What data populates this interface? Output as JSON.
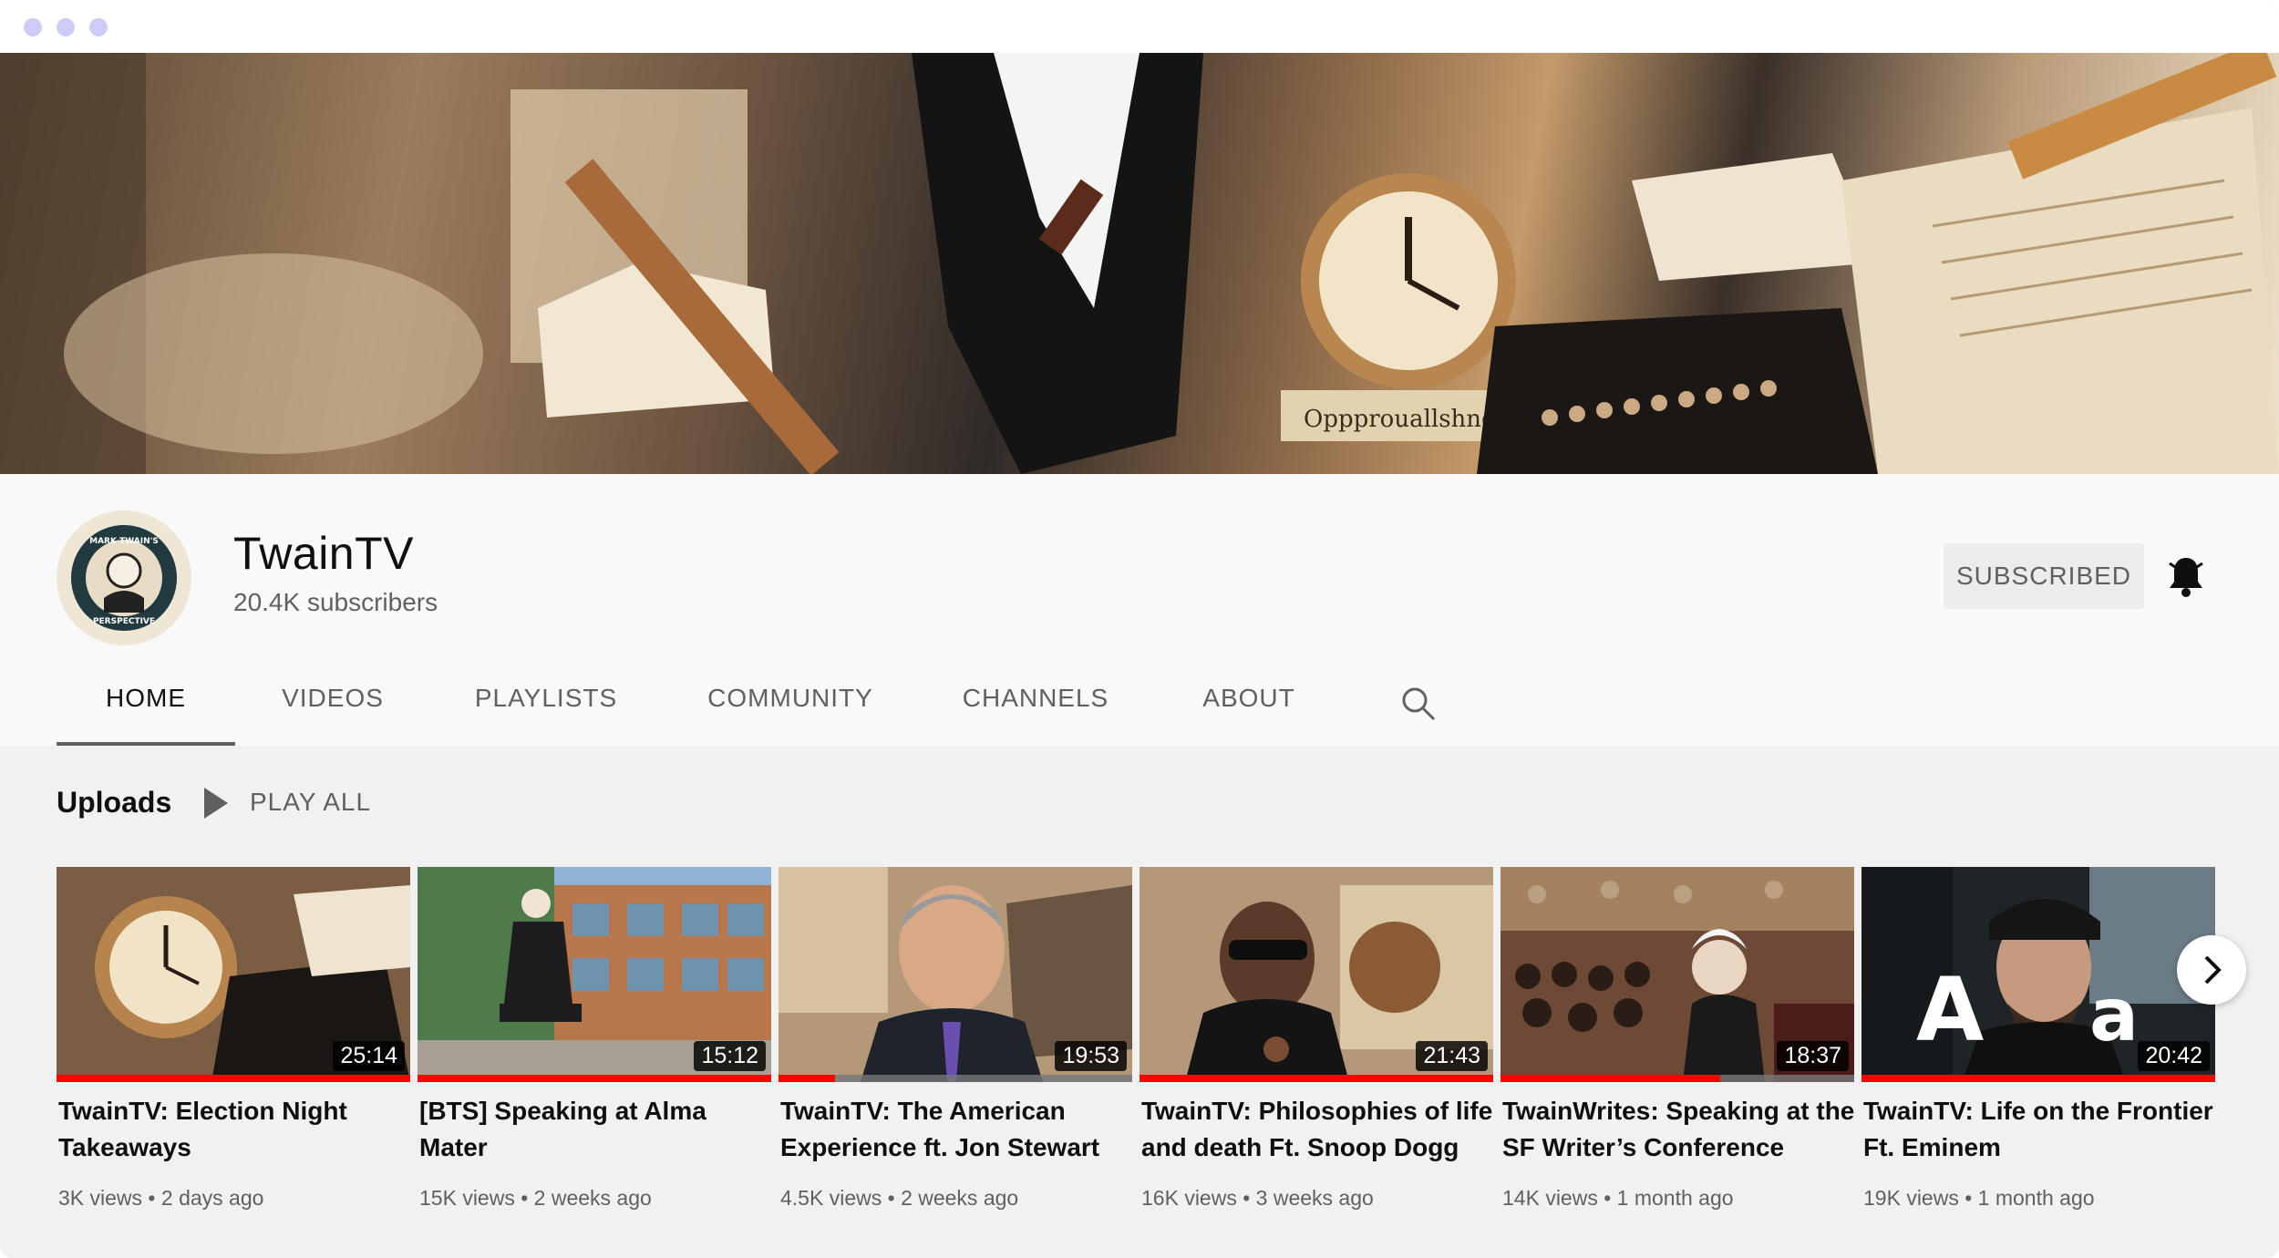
{
  "channel": {
    "name": "TwainTV",
    "subscribers": "20.4K subscribers",
    "avatar_text_top": "MARK TWAIN'S",
    "avatar_text_bottom": "PERSPECTIVE",
    "subscribe_label": "SUBSCRIBED"
  },
  "banner": {
    "sign_text": "Oppprouallshner"
  },
  "tabs": [
    {
      "label": "HOME",
      "active": true
    },
    {
      "label": "VIDEOS",
      "active": false
    },
    {
      "label": "PLAYLISTS",
      "active": false
    },
    {
      "label": "COMMUNITY",
      "active": false
    },
    {
      "label": "CHANNELS",
      "active": false
    },
    {
      "label": "ABOUT",
      "active": false
    }
  ],
  "uploads": {
    "title": "Uploads",
    "play_all_label": "PLAY ALL",
    "videos": [
      {
        "title": "TwainTV: Election Night Takeaways",
        "duration": "25:14",
        "views": "3K views",
        "age": "2 days ago",
        "watched": 1.0
      },
      {
        "title": "[BTS] Speaking at Alma Mater",
        "duration": "15:12",
        "views": "15K views",
        "age": "2 weeks ago",
        "watched": 1.0
      },
      {
        "title": "TwainTV: The American Experience ft. Jon Stewart",
        "duration": "19:53",
        "views": "4.5K views",
        "age": "2 weeks ago",
        "watched": 0.16
      },
      {
        "title": "TwainTV: Philosophies of life and death Ft. Snoop Dogg",
        "duration": "21:43",
        "views": "16K views",
        "age": "3 weeks ago",
        "watched": 1.0
      },
      {
        "title": "TwainWrites: Speaking at the SF Writer’s Conference",
        "duration": "18:37",
        "views": "14K views",
        "age": "1 month ago",
        "watched": 0.62
      },
      {
        "title": "TwainTV: Life on the Frontier Ft. Eminem",
        "duration": "20:42",
        "views": "19K views",
        "age": "1 month ago",
        "watched": 1.0
      }
    ]
  },
  "icons": {
    "bell": "bell-icon",
    "search": "search-icon",
    "play": "play-icon",
    "next": "chevron-right-icon"
  },
  "colors": {
    "progress": "#ff0000",
    "tab_indicator": "#606060"
  }
}
